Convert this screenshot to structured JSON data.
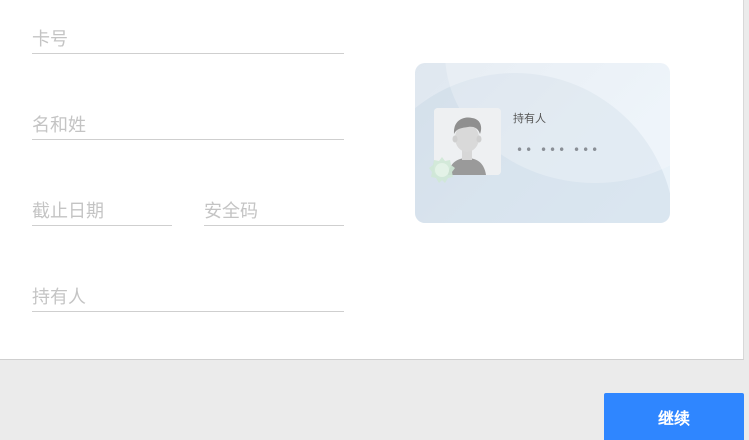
{
  "form": {
    "card_number_placeholder": "卡号",
    "name_placeholder": "名和姓",
    "expiry_placeholder": "截止日期",
    "cvv_placeholder": "安全码",
    "holder_placeholder": "持有人"
  },
  "card_preview": {
    "holder_label": "持有人",
    "masked_number": "•• ••• •••"
  },
  "actions": {
    "continue_label": "继续"
  },
  "colors": {
    "primary_button": "#2f86ff",
    "background": "#ebebeb"
  }
}
